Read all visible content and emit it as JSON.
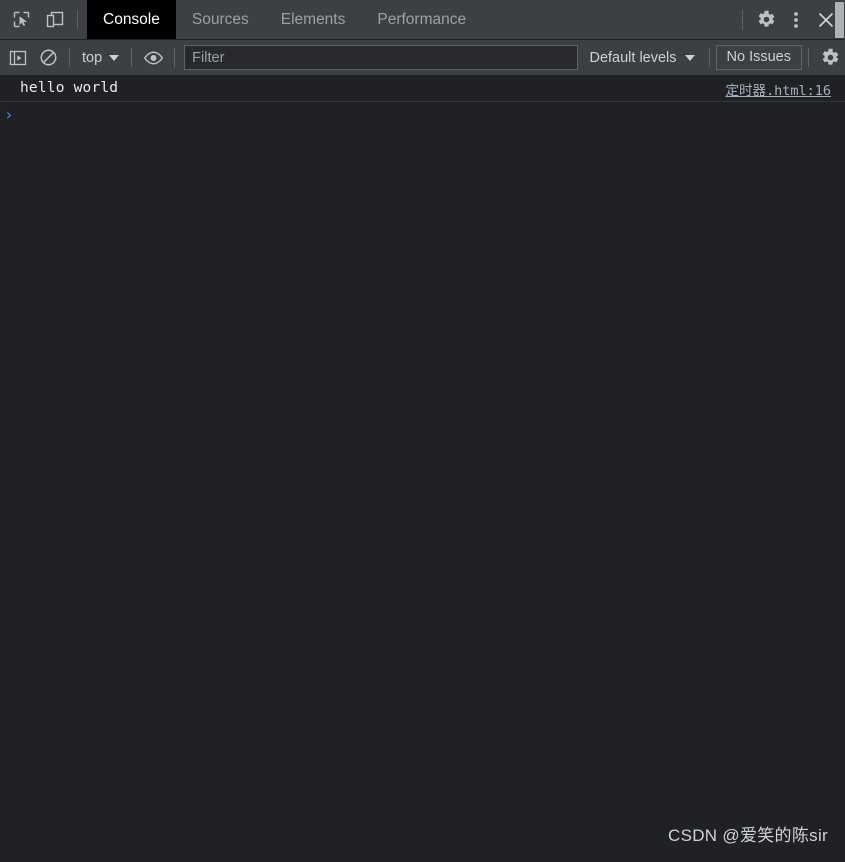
{
  "tabbar": {
    "inspect_icon": "inspect-element-icon",
    "device_icon": "device-toolbar-icon",
    "tabs": [
      {
        "label": "Console",
        "active": true
      },
      {
        "label": "Sources",
        "active": false
      },
      {
        "label": "Elements",
        "active": false
      },
      {
        "label": "Performance",
        "active": false
      }
    ],
    "settings_icon": "gear-icon",
    "more_icon": "more-vertical-icon",
    "close_icon": "close-icon"
  },
  "controlbar": {
    "sidebar_toggle_icon": "console-sidebar-icon",
    "clear_icon": "clear-console-icon",
    "context": {
      "label": "top"
    },
    "eye_icon": "live-expression-eye-icon",
    "filter": {
      "placeholder": "Filter",
      "value": ""
    },
    "levels": {
      "label": "Default levels"
    },
    "issues": {
      "label": "No Issues"
    },
    "settings_icon": "console-settings-gear-icon"
  },
  "console": {
    "messages": [
      {
        "text": "hello world",
        "source": "定时器.html:16"
      }
    ],
    "prompt": {
      "chevron": "›",
      "value": ""
    }
  },
  "watermark": {
    "text": "CSDN @爱笑的陈sir"
  },
  "colors": {
    "toolbar_bg": "#3c4043",
    "console_bg": "#202124",
    "active_tab_bg": "#000000",
    "text_primary": "#e8eaed",
    "text_muted": "#9aa0a6",
    "prompt_blue": "#4487f5",
    "link": "#a6b0bb",
    "scroll_green": "#3ec26b"
  }
}
